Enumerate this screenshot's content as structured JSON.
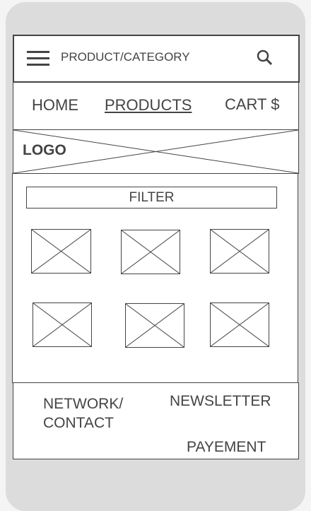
{
  "header": {
    "title": "PRODUCT/CATEGORY",
    "menu_icon": "hamburger-icon",
    "search_icon": "search-icon"
  },
  "nav": {
    "items": [
      {
        "label": "HOME"
      },
      {
        "label": "PRODUCTS",
        "active": true
      },
      {
        "label": "CART $"
      }
    ]
  },
  "logo": {
    "label": "LOGO"
  },
  "main": {
    "filter_label": "FILTER",
    "product_images": 6
  },
  "footer": {
    "network": "NETWORK/",
    "contact": "CONTACT",
    "newsletter": "NEWSLETTER",
    "payment": "PAYEMENT"
  },
  "colors": {
    "stroke": "#444444",
    "frame": "#dcdcdc",
    "background": "#f4f4f4"
  }
}
